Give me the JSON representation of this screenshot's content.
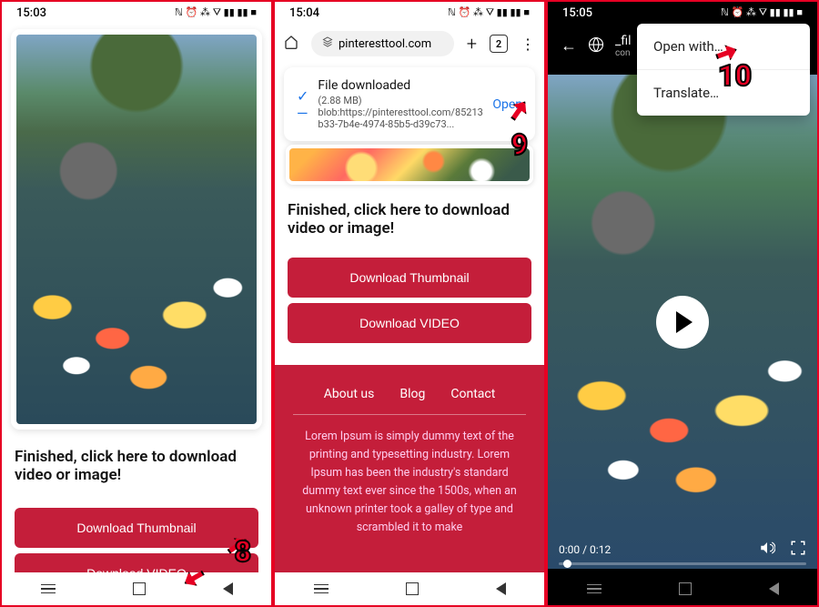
{
  "screen1": {
    "time": "15:03",
    "status_icons": "ℕ ⏰ ⁂ ⛛ ▮▮ ▮▮ ■",
    "finished_text": "Finished, click here to download video or image!",
    "download_thumbnail": "Download Thumbnail",
    "download_video": "Download VIDEO",
    "step_number": "8"
  },
  "screen2": {
    "time": "15:04",
    "status_icons": "ℕ ⏰ ⁂ ⛛ ▮▮ ▮▮ ■",
    "url": "pinteresttool.com",
    "tab_count": "2",
    "download": {
      "title": "File downloaded",
      "size": "(2.88 MB)",
      "blob": "blob:https://pinteresttool.com/85213b33-7b4e-4974-85b5-d39c73...",
      "open": "Open"
    },
    "finished_text": "Finished, click here to download video or image!",
    "download_thumbnail": "Download Thumbnail",
    "download_video": "Download VIDEO",
    "footer": {
      "about": "About us",
      "blog": "Blog",
      "contact": "Contact",
      "text": "Lorem Ipsum is simply dummy text of the printing and typesetting industry. Lorem Ipsum has been the industry's standard dummy text ever since the 1500s, when an unknown printer took a galley of type and scrambled it to make"
    },
    "step_number": "9"
  },
  "screen3": {
    "time": "15:05",
    "status_icons": "ℕ ⏰ ⁂ ⛛ ▮▮ ▮▮ ■",
    "url_prefix": "_fil",
    "url_sub": "con",
    "menu": {
      "open_with": "Open with…",
      "translate": "Translate…"
    },
    "controls": {
      "time": "0:00 / 0:12"
    },
    "step_number": "10"
  }
}
